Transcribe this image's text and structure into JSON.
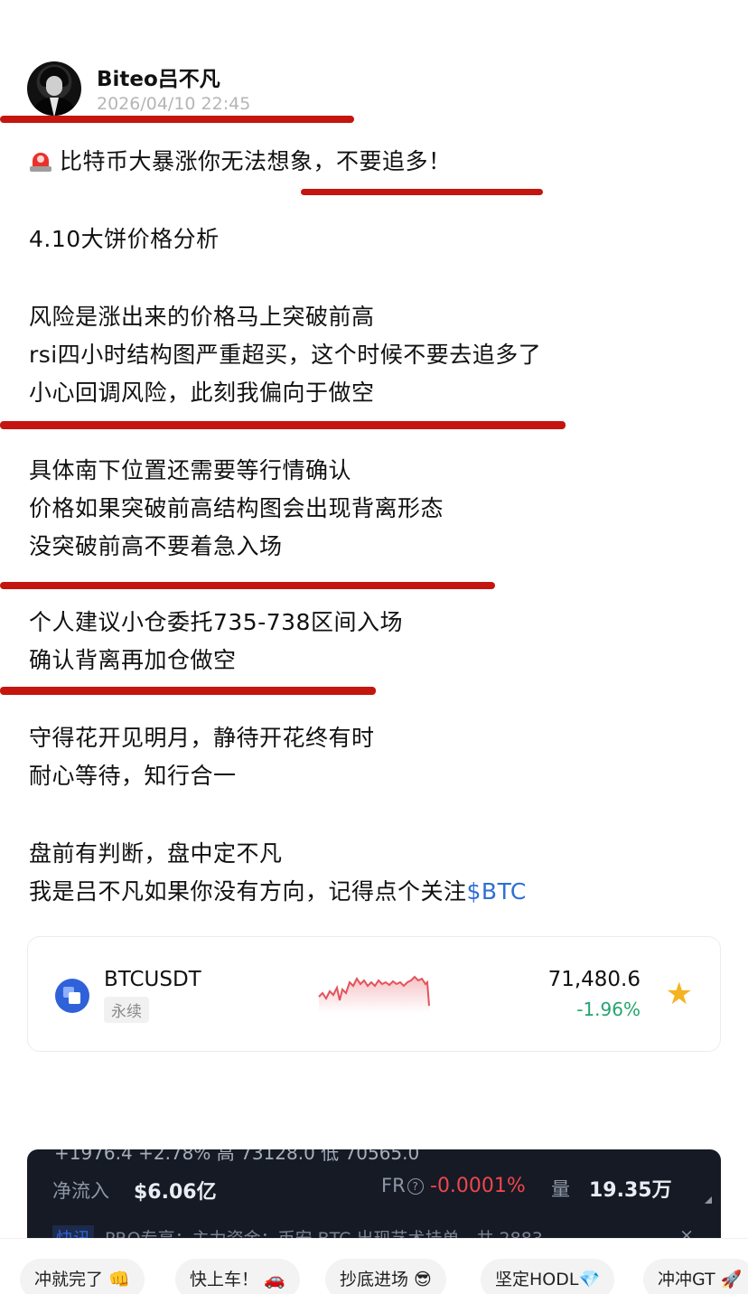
{
  "post": {
    "author": "Biteo吕不凡",
    "time": "2026/04/10 22:45",
    "headline": "比特币大暴涨你无法想象，不要追多！",
    "lines": [
      "4.10大饼价格分析",
      "风险是涨出来的价格马上突破前高",
      "rsi四小时结构图严重超买，这个时候不要去追多了",
      "小心回调风险，此刻我偏向于做空",
      "具体南下位置还需要等行情确认",
      "价格如果突破前高结构图会出现背离形态",
      "没突破前高不要着急入场",
      "个人建议小仓委托735-738区间入场",
      "确认背离再加仓做空",
      "守得花开见明月，静待开花终有时",
      "耐心等待，知行合一",
      "盘前有判断，盘中定不凡"
    ],
    "last_line_prefix": "我是吕不凡如果你没有方向，记得点个关注",
    "last_line_tag": "$BTC",
    "icon": "alarm-light-icon"
  },
  "ticker_card": {
    "symbol": "BTCUSDT",
    "badge": "永续",
    "price": "71,480.6",
    "change": "-1.96%",
    "change_color": "#25a470",
    "star_icon": "star-icon"
  },
  "market_banner": {
    "top_partial": "+1976.4    +2.78%                高   73128.0          低   70565.0",
    "net_inflow_label": "净流入",
    "net_inflow_value": "$6.06亿",
    "fr_label": "FR",
    "fr_value": "-0.0001%",
    "volume_label": "量",
    "volume_value": "19.35万",
    "flash_tag": "快讯",
    "flash_text": "PRO专享：主力资金：币安 BTC 出现艺术挂单，共 2883",
    "close_symbol": "×"
  },
  "quick_replies": [
    "冲就完了 👊",
    "快上车！ 🚗",
    "抄底进场 😎",
    "坚定HODL💎",
    "冲冲GT 🚀"
  ],
  "colors": {
    "underline_red": "#c4150f",
    "link_blue": "#2d6fd6",
    "banner_bg": "#151a24"
  }
}
